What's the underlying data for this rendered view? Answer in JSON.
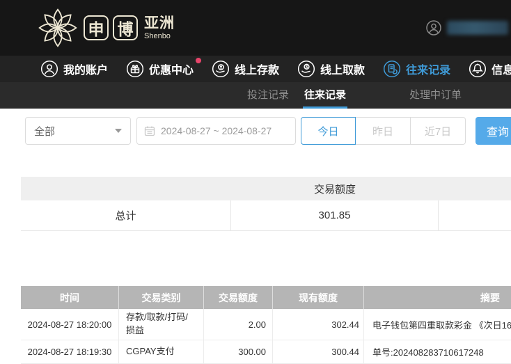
{
  "brand": {
    "char1": "申",
    "char2": "博",
    "region": "亚洲",
    "sub": "Shenbo",
    "flower_icon": "flower-logo-icon"
  },
  "header": {
    "user": {
      "masked": true,
      "avatar_icon": "user-avatar-icon"
    }
  },
  "nav": {
    "items": [
      {
        "label": "我的账户",
        "icon": "user-icon",
        "active": false
      },
      {
        "label": "优惠中心",
        "icon": "gift-icon",
        "active": false,
        "badge": true
      },
      {
        "label": "线上存款",
        "icon": "deposit-coin-icon",
        "active": false
      },
      {
        "label": "线上取款",
        "icon": "withdraw-coin-icon",
        "active": false
      },
      {
        "label": "往来记录",
        "icon": "records-icon",
        "active": true
      },
      {
        "label": "信息",
        "icon": "bell-icon",
        "active": false
      }
    ]
  },
  "tabs": {
    "items": [
      {
        "label": "投注记录",
        "active": false
      },
      {
        "label": "往来记录",
        "active": true
      },
      {
        "label": "处理中订单",
        "active": false
      }
    ]
  },
  "filters": {
    "type_select": {
      "value": "全部",
      "icon": "chevron-down-icon"
    },
    "date_range": {
      "value": "2024-08-27 ~ 2024-08-27",
      "icon": "calendar-icon"
    },
    "quick": [
      {
        "label": "今日",
        "active": true
      },
      {
        "label": "昨日",
        "active": false
      },
      {
        "label": "近7日",
        "active": false
      }
    ],
    "query_label": "查询"
  },
  "summary": {
    "header": "交易额度",
    "total_label": "总计",
    "total_value": "301.85"
  },
  "records": {
    "columns": [
      "时间",
      "交易类别",
      "交易额度",
      "现有额度",
      "摘要"
    ],
    "rows": [
      {
        "time": "2024-08-27 18:20:00",
        "type": "存款/取款/打码/损益",
        "amount": "2.00",
        "balance": "302.44",
        "summary": "电子钱包第四重取款彩金 《次日16"
      },
      {
        "time": "2024-08-27 18:19:30",
        "type": "CGPAY支付",
        "amount": "300.00",
        "balance": "300.44",
        "summary": "单号:202408283710617248"
      }
    ]
  },
  "colors": {
    "accent_blue": "#3f9bd8",
    "query_button_blue": "#55aae9",
    "badge_red": "#e8456b",
    "header_black": "#161616",
    "nav_black": "#232323",
    "subtab_black": "#2b2b2b",
    "logo_cream": "#ece6d2",
    "summary_header_bg": "#efefef",
    "table_header_bg": "#b5b5b5"
  }
}
